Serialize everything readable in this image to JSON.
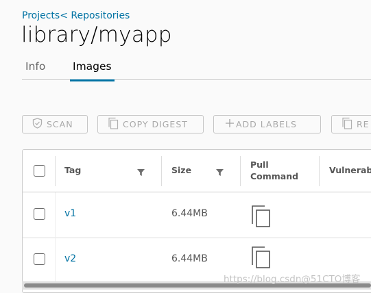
{
  "breadcrumb": {
    "projects": "Projects",
    "separator": "<",
    "repositories": "Repositories"
  },
  "page": {
    "title": "library/myapp"
  },
  "tabs": [
    {
      "label": "Info",
      "active": false
    },
    {
      "label": "Images",
      "active": true
    }
  ],
  "toolbar": {
    "scan_label": "SCAN",
    "copy_digest_label": "COPY DIGEST",
    "add_labels_label": "ADD LABELS",
    "retag_label_partial": "RE",
    "icons": {
      "scan": "shield-check-icon",
      "copy_digest": "copy-icon",
      "add_labels": "plus-icon",
      "retag": "copy-icon"
    }
  },
  "table": {
    "columns": [
      {
        "label": "Tag",
        "filterable": true
      },
      {
        "label": "Size",
        "filterable": true
      },
      {
        "label": "Pull\nCommand",
        "filterable": false
      },
      {
        "label": "Vulnerab",
        "filterable": false
      }
    ],
    "rows": [
      {
        "tag": "v1",
        "size": "6.44MB",
        "pull_command_icon": "copy-icon"
      },
      {
        "tag": "v2",
        "size": "6.44MB",
        "pull_command_icon": "copy-icon"
      }
    ]
  },
  "watermark": "https://blog.csdn@51CTO博客",
  "colors": {
    "accent": "#0072a3",
    "disabled_text": "#a9a9a9",
    "border": "#cccccc",
    "background": "#fafafa"
  }
}
